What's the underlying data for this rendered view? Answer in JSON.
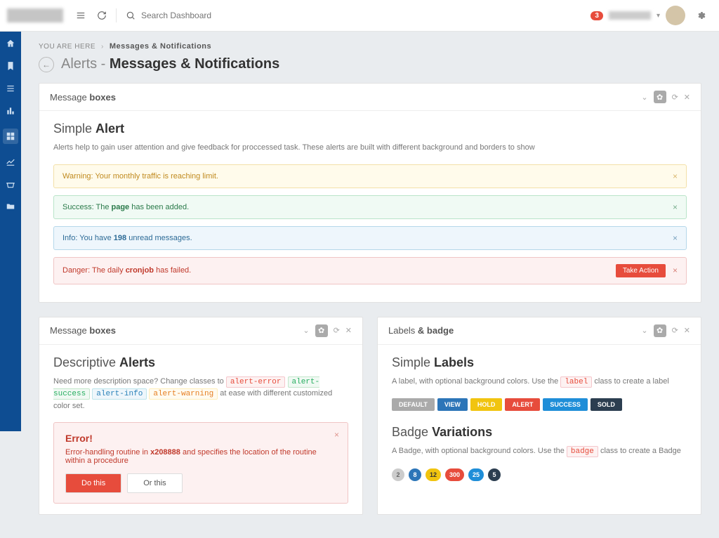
{
  "topbar": {
    "search_placeholder": "Search Dashboard",
    "notif_count": "3"
  },
  "breadcrumb": {
    "label": "YOU ARE HERE",
    "current": "Messages & Notifications"
  },
  "page_title": {
    "prefix": "Alerts - ",
    "main": "Messages & Notifications"
  },
  "panel1": {
    "head_prefix": "Message ",
    "head_bold": "boxes",
    "title_prefix": "Simple ",
    "title_bold": "Alert",
    "desc": "Alerts help to gain user attention and give feedback for proccessed task. These alerts are built with different background and borders to show",
    "alerts": {
      "warning": "Warning: Your monthly traffic is reaching limit.",
      "success_pre": "Success: The ",
      "success_bold": "page",
      "success_post": " has been added.",
      "info_pre": "Info: You have ",
      "info_bold": "198",
      "info_post": " unread messages.",
      "danger_pre": "Danger: The daily ",
      "danger_bold": "cronjob",
      "danger_post": " has failed.",
      "take_action": "Take Action"
    }
  },
  "panel2": {
    "head_prefix": "Message ",
    "head_bold": "boxes",
    "title_prefix": "Descriptive ",
    "title_bold": "Alerts",
    "desc_pre": "Need more description space? Change classes to ",
    "chips": {
      "err": "alert-error",
      "succ": "alert-success",
      "info": "alert-info",
      "warn": "alert-warning"
    },
    "desc_post": " at ease with different customized color set.",
    "box": {
      "title": "Error!",
      "body_pre": "Error-handling routine in ",
      "body_bold": "x208888",
      "body_post": " and specifies the location of the routine within a procedure",
      "btn1": "Do this",
      "btn2": "Or this"
    }
  },
  "panel3": {
    "head_prefix": "Labels ",
    "head_bold": "& badge",
    "t1_pre": "Simple ",
    "t1_bold": "Labels",
    "d1_pre": "A label, with optional background colors. Use the ",
    "d1_chip": "label",
    "d1_post": " class to create a label",
    "labels": [
      "DEFAULT",
      "VIEW",
      "HOLD",
      "ALERT",
      "SUCCESS",
      "SOLD"
    ],
    "t2_pre": "Badge ",
    "t2_bold": "Variations",
    "d2_pre": "A Badge, with optional background colors. Use the ",
    "d2_chip": "badge",
    "d2_post": " class to create a Badge",
    "badges": [
      "2",
      "8",
      "12",
      "300",
      "25",
      "5"
    ]
  }
}
